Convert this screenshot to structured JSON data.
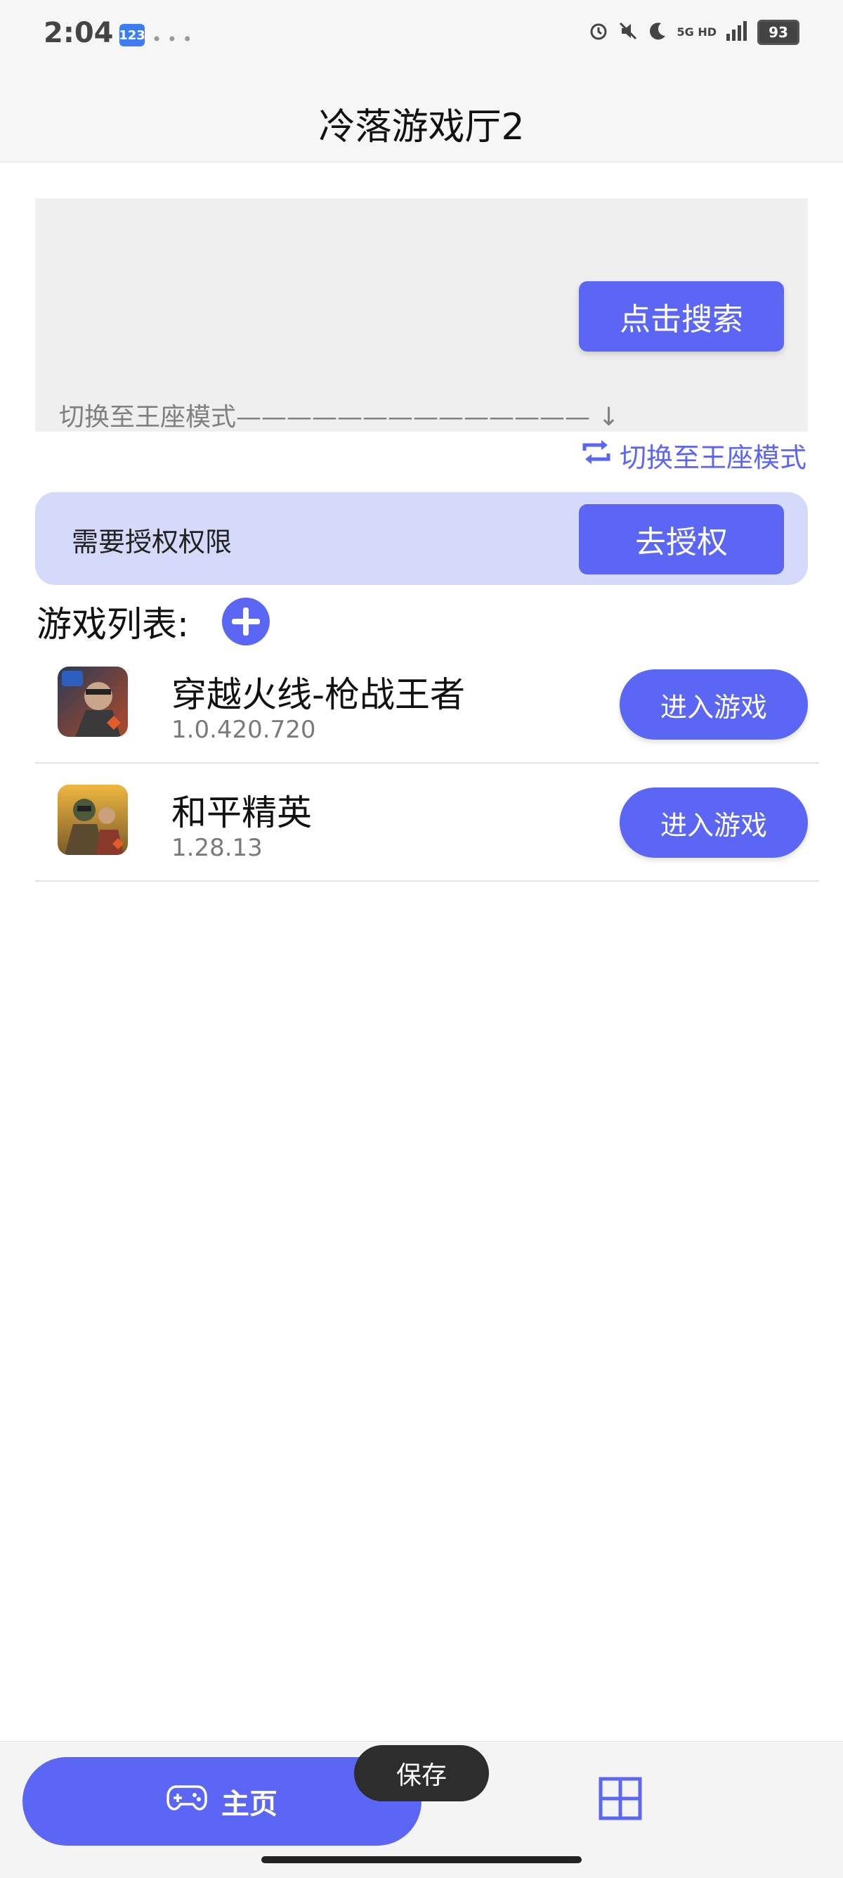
{
  "status_bar": {
    "time": "2:04",
    "badge": "123",
    "network_top": "5G HD",
    "battery": "93"
  },
  "header": {
    "title": "冷落游戏厅2"
  },
  "search": {
    "button_label": "点击搜索",
    "switch_hint": "切换至王座模式—————————————— ↓",
    "switch_link": "切换至王座模式"
  },
  "auth": {
    "text": "需要授权权限",
    "button_label": "去授权"
  },
  "game_list": {
    "heading": "游戏列表:",
    "games": [
      {
        "name": "穿越火线-枪战王者",
        "version": "1.0.420.720",
        "action": "进入游戏"
      },
      {
        "name": "和平精英",
        "version": "1.28.13",
        "action": "进入游戏"
      }
    ]
  },
  "bottom_nav": {
    "home_label": "主页",
    "toast": "保存"
  },
  "colors": {
    "accent": "#5b66f5",
    "auth_bg": "#d5dafa"
  }
}
